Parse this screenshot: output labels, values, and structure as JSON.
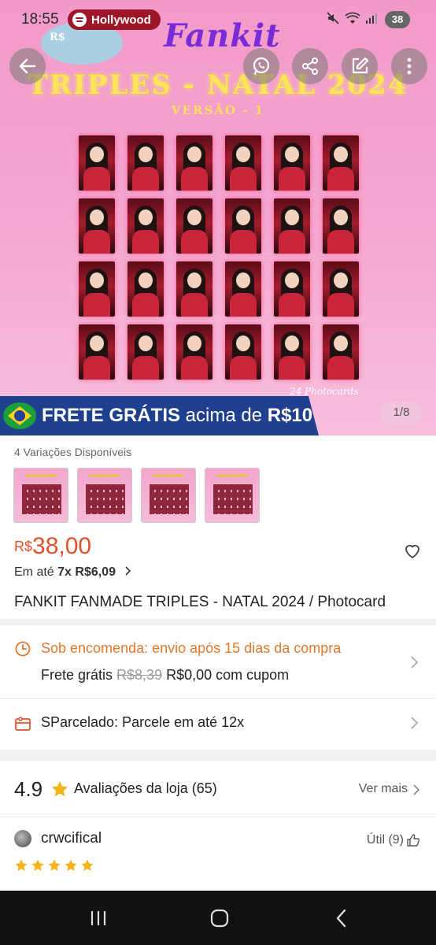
{
  "status_bar": {
    "time": "18:55",
    "now_playing": "Hollywood",
    "battery": "38"
  },
  "hero": {
    "rs_mark": "R$",
    "brand": "Fankit",
    "headline": "TRIPLES - NATAL 2024",
    "version": "VERSÃO - 1",
    "photocards_caption": "24 Photocards",
    "pager": "1/8"
  },
  "banner": {
    "frete_bold": "FRETE GRÁTIS",
    "frete_rest": " acima de ",
    "frete_amount": "R$10"
  },
  "product": {
    "variations_label": "4 Variações Disponíveis",
    "price_currency": "R$",
    "price_value": "38,00",
    "installments_prefix": "Em até ",
    "installments_bold": "7x R$6,09",
    "title": "FANKIT FANMADE TRIPLES - NATAL 2024 / Photocard"
  },
  "shipping": {
    "sob_encomenda": "Sob encomenda: envio após 15 dias da compra",
    "frete_label": "Frete grátis ",
    "frete_old": "R$8,39",
    "frete_new": " R$0,00 com cupom"
  },
  "payment": {
    "label": "SParcelado: Parcele em até 12x"
  },
  "ratings": {
    "score": "4.9",
    "label": "Avaliações da loja (65)",
    "see_more": "Ver mais"
  },
  "review": {
    "user": "crwcifical",
    "useful": "Útil (9)",
    "stars": 5
  },
  "colors": {
    "price": "#e2502b",
    "sob_encomenda": "#e2782b",
    "banner_blue": "#1f3f8f",
    "star_gold": "#f5b31a"
  }
}
